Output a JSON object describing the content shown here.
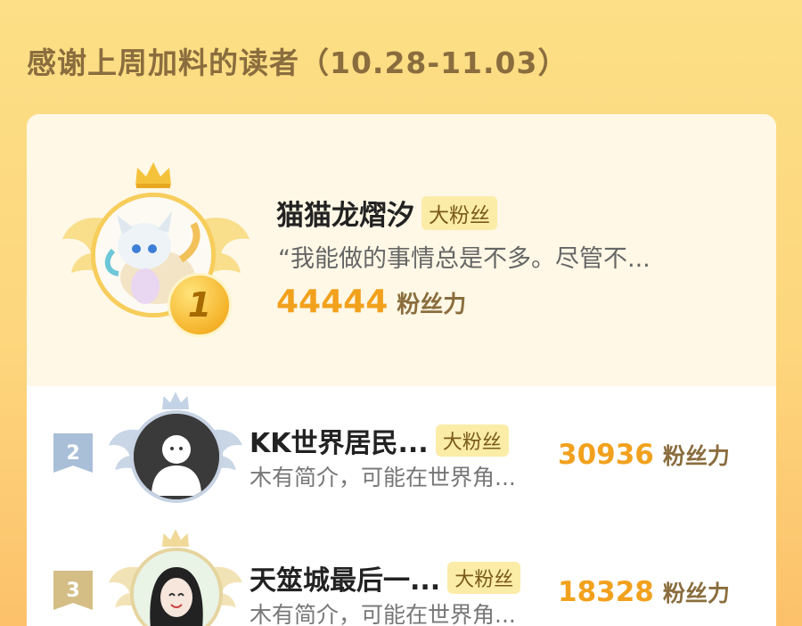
{
  "header": {
    "title": "感谢上周加料的读者（10.28-11.03）"
  },
  "first": {
    "rank": "1",
    "name": "猫猫龙熠汐",
    "tag": "大粉丝",
    "quote": "“我能做的事情总是不多。尽管不...",
    "score": "44444",
    "unit": "粉丝力"
  },
  "list": [
    {
      "rank": "2",
      "name": "KK世界居民...",
      "tag": "大粉丝",
      "desc": "木有简介，可能在世界角...",
      "score": "30936",
      "unit": "粉丝力"
    },
    {
      "rank": "3",
      "name": "天筮城最后一...",
      "tag": "大粉丝",
      "desc": "木有简介，可能在世界角...",
      "score": "18328",
      "unit": "粉丝力"
    }
  ],
  "colors": {
    "gold": "#f2a11d",
    "bg": "#fcdf86",
    "silver": "#9fb4cf",
    "bronze": "#d7c38f"
  }
}
